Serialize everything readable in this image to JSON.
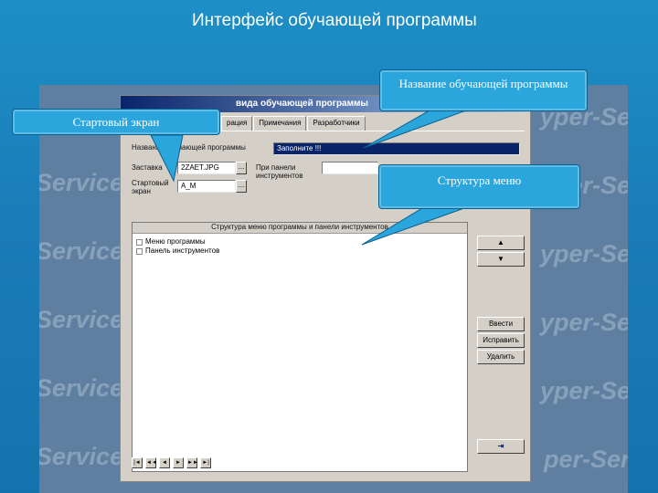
{
  "slide": {
    "title": "Интерфейс обучающей программы"
  },
  "watermark": {
    "word_left": "Service",
    "word_right": "yper-Serv",
    "word_right_alt": "yper-Servi",
    "word_right_short": "per-Serv"
  },
  "app": {
    "title_text": "вида обучающей программы",
    "tabs": [
      "рация",
      "Примечания",
      "Разработчики"
    ],
    "name_label": "Название обучающей программы",
    "name_value": "Заполните !!!",
    "screen_label": "Заставка",
    "screen_value": "2ZAET.JPG",
    "start_label": "Стартовый экран",
    "start_value": "A_M",
    "toolbar_label": "При панели инструментов",
    "dots_label": "...",
    "tree_header": "Структура меню программы и панели инструментов",
    "tree_items": [
      "Меню программы",
      "Панель инструментов"
    ],
    "nav_buttons": [
      "|◄",
      "◄◄",
      "◄",
      "►",
      "►►",
      "►|"
    ],
    "side_buttons": {
      "up": "▲",
      "down": "▼",
      "add": "Ввести",
      "edit": "Исправить",
      "delete": "Удалить",
      "exit": "⇥"
    }
  },
  "callouts": {
    "program_name": "Название обучающей программы",
    "start_screen": "Стартовый экран",
    "menu_structure": "Структура меню"
  },
  "colors": {
    "background": "#1a7cb8",
    "callout": "#2aa6dd",
    "highlight": "#0a246a"
  }
}
